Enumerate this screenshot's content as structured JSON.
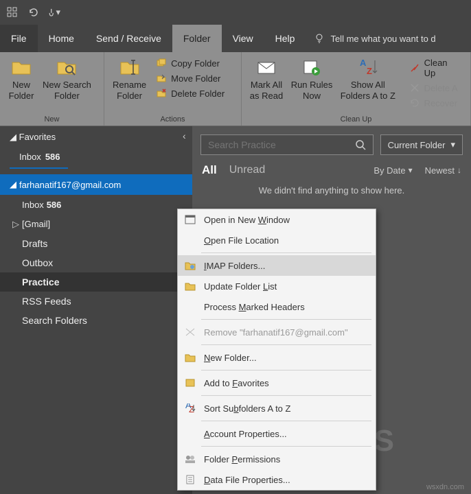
{
  "titlebar": {
    "qat": [
      "grid",
      "undo",
      "touch"
    ]
  },
  "menubar": {
    "file": "File",
    "home": "Home",
    "sendrecv": "Send / Receive",
    "folder": "Folder",
    "view": "View",
    "help": "Help",
    "tell": "Tell me what you want to d"
  },
  "ribbon": {
    "group_new": "New",
    "group_actions": "Actions",
    "group_cleanup": "Clean Up",
    "new_folder": "New\nFolder",
    "new_search_folder": "New Search\nFolder",
    "rename_folder": "Rename\nFolder",
    "copy_folder": "Copy Folder",
    "move_folder": "Move Folder",
    "delete_folder": "Delete Folder",
    "mark_all_read": "Mark All\nas Read",
    "run_rules_now": "Run Rules\nNow",
    "show_all_az": "Show All\nFolders A to Z",
    "clean_up": "Clean Up",
    "delete_all": "Delete A",
    "recover": "Recover"
  },
  "sidebar": {
    "favorites": "Favorites",
    "inbox": "Inbox",
    "inbox_count": "586",
    "account": "farhanatif167@gmail.com",
    "items": {
      "inbox2": "Inbox",
      "inbox2_count": "586",
      "gmail": "[Gmail]",
      "drafts": "Drafts",
      "outbox": "Outbox",
      "practice": "Practice",
      "rss": "RSS Feeds",
      "search_folders": "Search Folders"
    }
  },
  "content": {
    "search_placeholder": "Search Practice",
    "scope": "Current Folder",
    "all": "All",
    "unread": "Unread",
    "by_date": "By Date",
    "newest": "Newest",
    "empty": "We didn't find anything to show here."
  },
  "ctx": {
    "open_new_window": "Open in New Window",
    "open_file_loc": "Open File Location",
    "imap": "IMAP Folders...",
    "update_list": "Update Folder List",
    "process_marked": "Process Marked Headers",
    "remove": "Remove \"farhanatif167@gmail.com\"",
    "new_folder": "New Folder...",
    "add_fav": "Add to Favorites",
    "sort_az": "Sort Subfolders A to Z",
    "acct_props": "Account Properties...",
    "folder_perm": "Folder Permissions",
    "data_file_props": "Data File Properties..."
  },
  "watermark": "wsxdn.com"
}
